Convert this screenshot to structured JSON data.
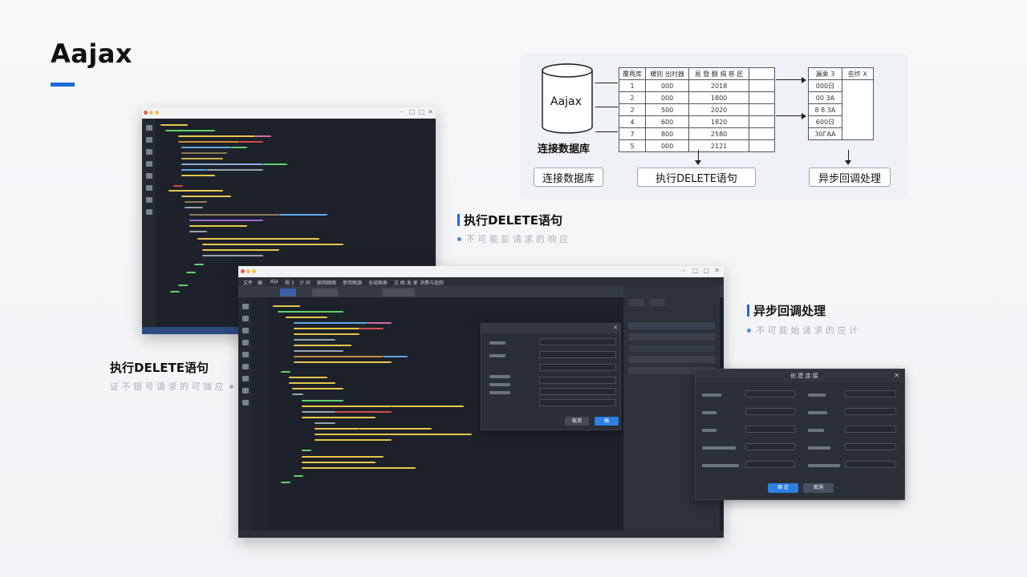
{
  "page": {
    "title": "Aajax"
  },
  "colors": {
    "accent": "#1f6bdc",
    "editor_bg": "#1d2129",
    "button_blue": "#2c7fe3"
  },
  "diagram": {
    "db_text": "Aajax",
    "db_label": "连接数据库",
    "table_headers": [
      "覆两库",
      "暖则 出时器",
      "易 暨 翻 揭 慈 匠"
    ],
    "table_rows": [
      [
        "1",
        "000",
        "2018"
      ],
      [
        "2",
        "000",
        "1800"
      ],
      [
        "2",
        "500",
        "2020"
      ],
      [
        "4",
        "600",
        "1820"
      ],
      [
        "7",
        "800",
        "2580"
      ],
      [
        "5",
        "000",
        "2121"
      ]
    ],
    "result_headers": [
      "漏乘 3",
      "些炸 X"
    ],
    "result_rows": [
      "000日",
      "00 3A",
      "8 8 3A",
      "600日",
      "30ГАА"
    ],
    "boxes": [
      "连接数据库",
      "执行DELETE语句",
      "异步回调处理"
    ]
  },
  "labels": {
    "delete_main": "执行DELETE语句",
    "delete_main_sub": "不 可 能 彭 请 求 的 响 应",
    "delete_left": "执行DELETE语句",
    "delete_left_sub": "证 不 银 号 请 求 的 可 瑞 应",
    "async": "异步回调处理",
    "async_sub": "不 可 能 始 请 求 的 应 计"
  },
  "front_editor": {
    "menu": [
      "文件",
      "编",
      "Aja",
      "视 3",
      "计 间",
      "联网络图",
      "使用图源",
      "全局图表",
      "文 图 发 更",
      "消费与追踪"
    ]
  },
  "settings_dialog": {
    "title": "创 建 连 接",
    "confirm": "确 定",
    "cancel": "取消"
  },
  "find_dialog": {
    "confirm": "确",
    "cancel": "取消"
  }
}
